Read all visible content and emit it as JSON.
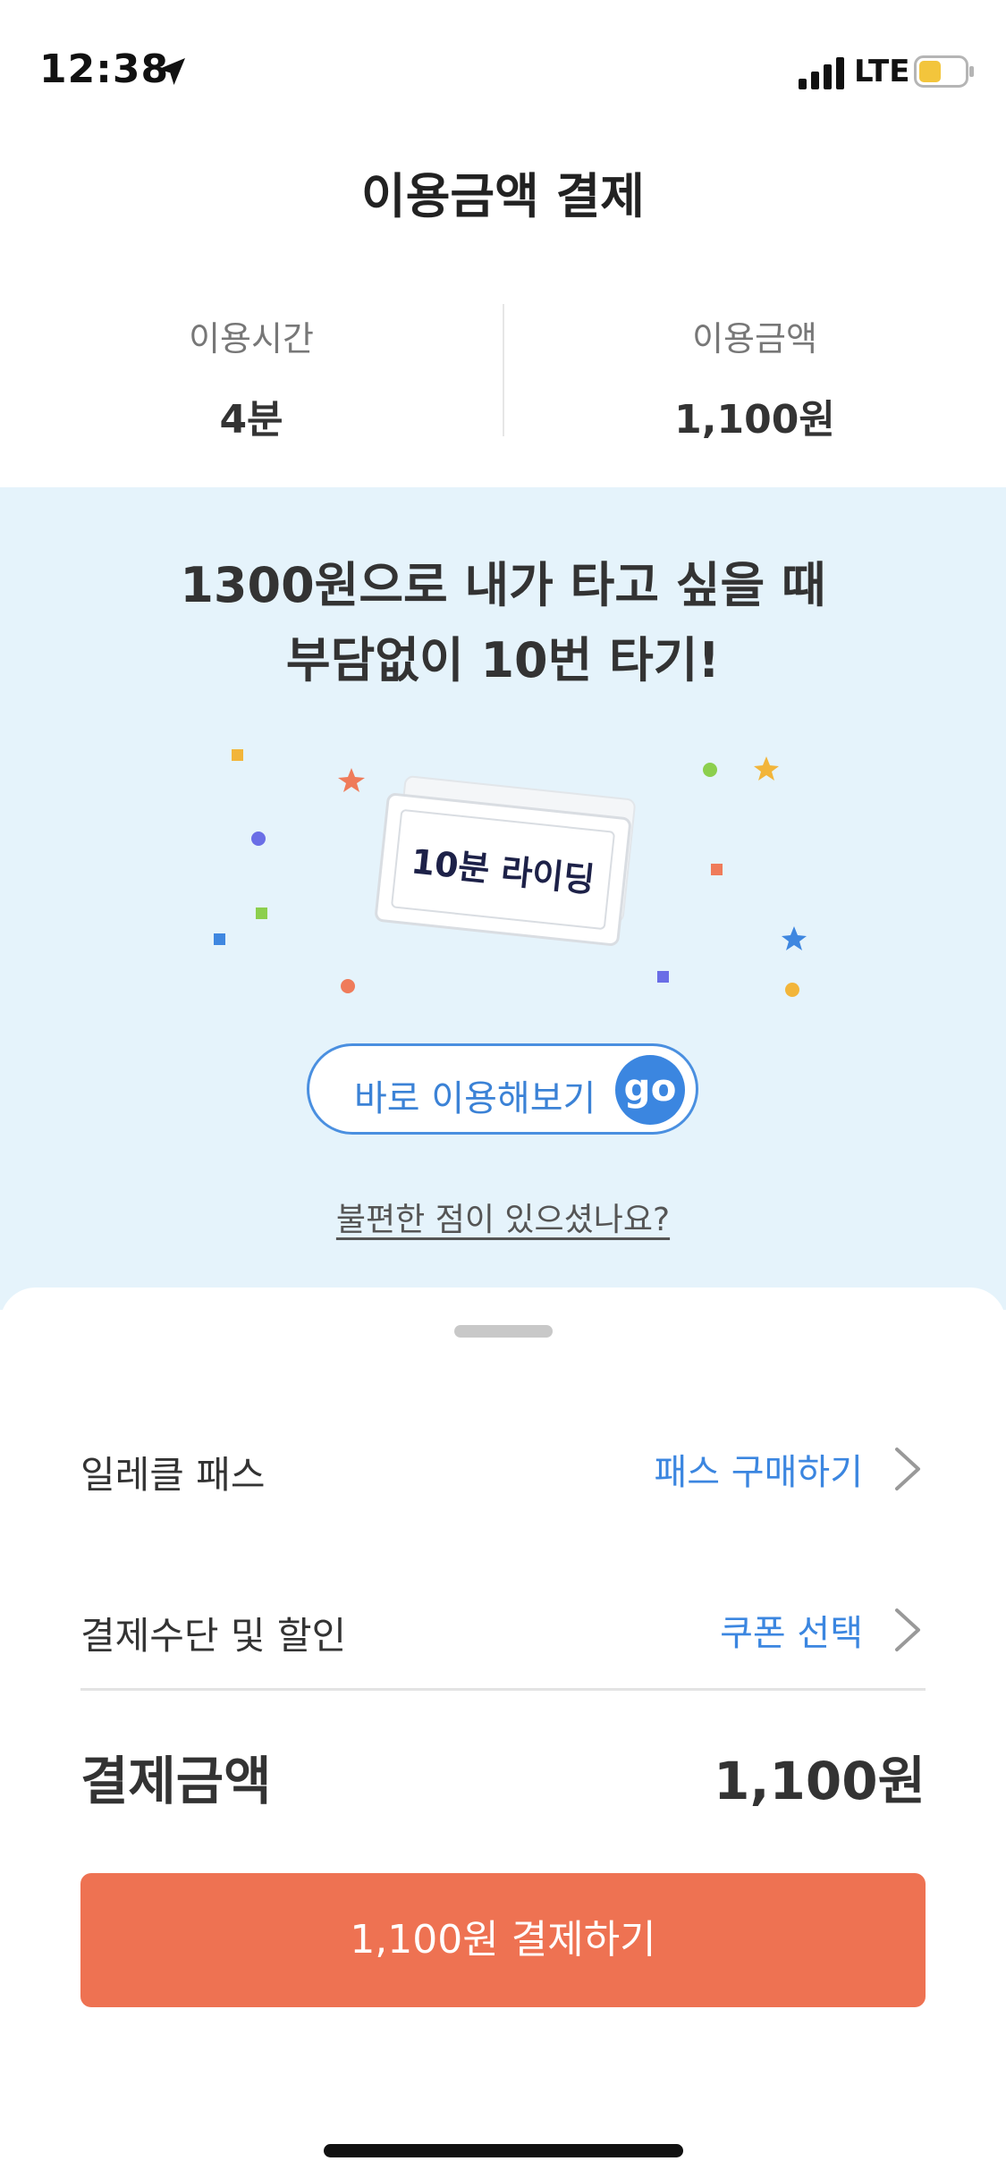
{
  "status_bar": {
    "time": "12:38",
    "network": "LTE",
    "icons": [
      "location-arrow-icon",
      "signal-icon",
      "battery-icon"
    ]
  },
  "header": {
    "title": "이용금액 결제"
  },
  "summary": {
    "time_label": "이용시간",
    "time_value": "4분",
    "amount_label": "이용금액",
    "amount_value": "1,100원"
  },
  "promo": {
    "title_line1": "1300원으로 내가 타고 싶을 때",
    "title_line2": "부담없이 10번 타기!",
    "ticket_label": "10분 라이딩",
    "go_button_label": "바로 이용해보기",
    "go_badge": "go",
    "feedback_link": "불편한 점이 있으셨나요?"
  },
  "sheet": {
    "pass_label": "일레클 패스",
    "pass_action": "패스 구매하기",
    "payment_label": "결제수단 및 할인",
    "payment_action": "쿠폰 선택",
    "total_label": "결제금액",
    "total_value": "1,100원",
    "pay_button": "1,100원 결제하기"
  },
  "colors": {
    "accent": "#3b86e0",
    "pay_button": "#ee7252",
    "promo_bg": "#e5f3fb"
  }
}
